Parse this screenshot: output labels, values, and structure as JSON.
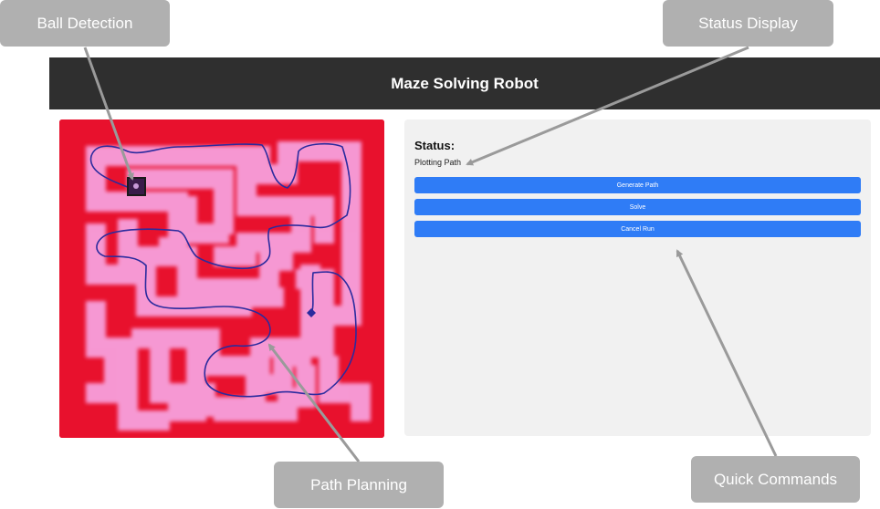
{
  "header": {
    "title": "Maze Solving Robot"
  },
  "status": {
    "label": "Status:",
    "value": "Plotting Path"
  },
  "commands": [
    {
      "label": "Generate Path"
    },
    {
      "label": "Solve"
    },
    {
      "label": "Cancel Run"
    }
  ],
  "annotations": {
    "ball_detection": "Ball Detection",
    "status_display": "Status Display",
    "path_planning": "Path Planning",
    "quick_commands": "Quick Commands"
  },
  "colors": {
    "header_bg": "#2f2f2f",
    "button": "#2f7cf6",
    "maze_wall": "#e8112d",
    "maze_corridor": "#f7a0dc",
    "path_line": "#2b2b9e",
    "callout_bg": "#b0b0b0"
  }
}
